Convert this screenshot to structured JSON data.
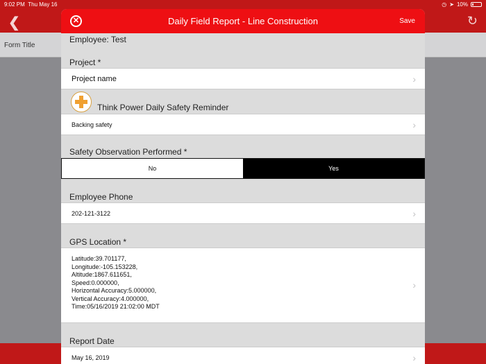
{
  "status_bar": {
    "time": "9:02 PM",
    "date": "Thu May 16",
    "battery": "10%"
  },
  "background": {
    "form_title": "Form Title"
  },
  "modal": {
    "title": "Daily Field Report - Line Construction",
    "save_label": "Save"
  },
  "form": {
    "employee_label": "Employee: Test",
    "project_label": "Project *",
    "project_value": "Project name",
    "reminder_label": "Think Power Daily Safety Reminder",
    "reminder_value": "Backing safety",
    "safety_label": "Safety Observation Performed *",
    "safety_options": {
      "no": "No",
      "yes": "Yes"
    },
    "safety_selected": "Yes",
    "phone_label": "Employee Phone",
    "phone_value": "202-121-3122",
    "gps_label": "GPS Location *",
    "gps_lines": [
      "Latitude:39.701177,",
      "Longitude:-105.153228,",
      "Altitude:1867.611651,",
      "Speed:0.000000,",
      "Horizontal Accuracy:5.000000,",
      "Vertical Accuracy:4.000000,",
      "Time:05/16/2019 21:02:00 MDT"
    ],
    "report_date_label": "Report Date",
    "report_date_value": "May 16, 2019"
  }
}
